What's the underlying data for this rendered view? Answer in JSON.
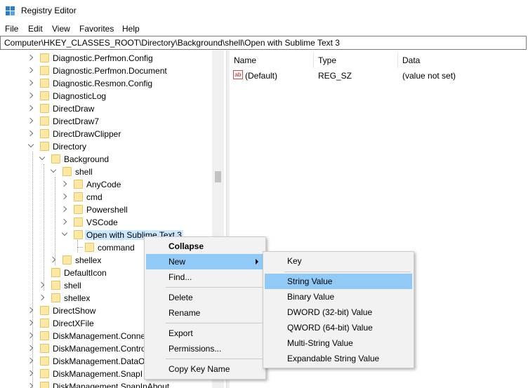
{
  "window": {
    "title": "Registry Editor"
  },
  "menubar": [
    "File",
    "Edit",
    "View",
    "Favorites",
    "Help"
  ],
  "address": "Computer\\HKEY_CLASSES_ROOT\\Directory\\Background\\shell\\Open with Sublime Text 3",
  "tree": [
    {
      "label": "Diagnostic.Perfmon.Config"
    },
    {
      "label": "Diagnostic.Perfmon.Document"
    },
    {
      "label": "Diagnostic.Resmon.Config"
    },
    {
      "label": "DiagnosticLog"
    },
    {
      "label": "DirectDraw"
    },
    {
      "label": "DirectDraw7"
    },
    {
      "label": "DirectDrawClipper"
    },
    {
      "label": "Directory"
    },
    {
      "label": "Background"
    },
    {
      "label": "shell"
    },
    {
      "label": "AnyCode"
    },
    {
      "label": "cmd"
    },
    {
      "label": "Powershell"
    },
    {
      "label": "VSCode"
    },
    {
      "label": "Open with Sublime Text 3"
    },
    {
      "label": "command"
    },
    {
      "label": "shellex"
    },
    {
      "label": "DefaultIcon"
    },
    {
      "label": "shell"
    },
    {
      "label": "shellex"
    },
    {
      "label": "DirectShow"
    },
    {
      "label": "DirectXFile"
    },
    {
      "label": "DiskManagement.Conne"
    },
    {
      "label": "DiskManagement.Contro"
    },
    {
      "label": "DiskManagement.DataO"
    },
    {
      "label": "DiskManagement.SnapI"
    },
    {
      "label": "DiskManagement.SnapInAbout"
    }
  ],
  "list": {
    "headers": {
      "name": "Name",
      "type": "Type",
      "data": "Data"
    },
    "rows": [
      {
        "name": "(Default)",
        "type": "REG_SZ",
        "data": "(value not set)",
        "icon": "ab-string-icon"
      }
    ]
  },
  "context_menu": [
    "Collapse",
    "New",
    "Find...",
    "Delete",
    "Rename",
    "Export",
    "Permissions...",
    "Copy Key Name"
  ],
  "submenu": [
    "Key",
    "String Value",
    "Binary Value",
    "DWORD (32-bit) Value",
    "QWORD (64-bit) Value",
    "Multi-String Value",
    "Expandable String Value"
  ],
  "colors": {
    "highlight": "#91c9f7",
    "selection": "#cce8ff",
    "folder": "#ffe9a2"
  }
}
